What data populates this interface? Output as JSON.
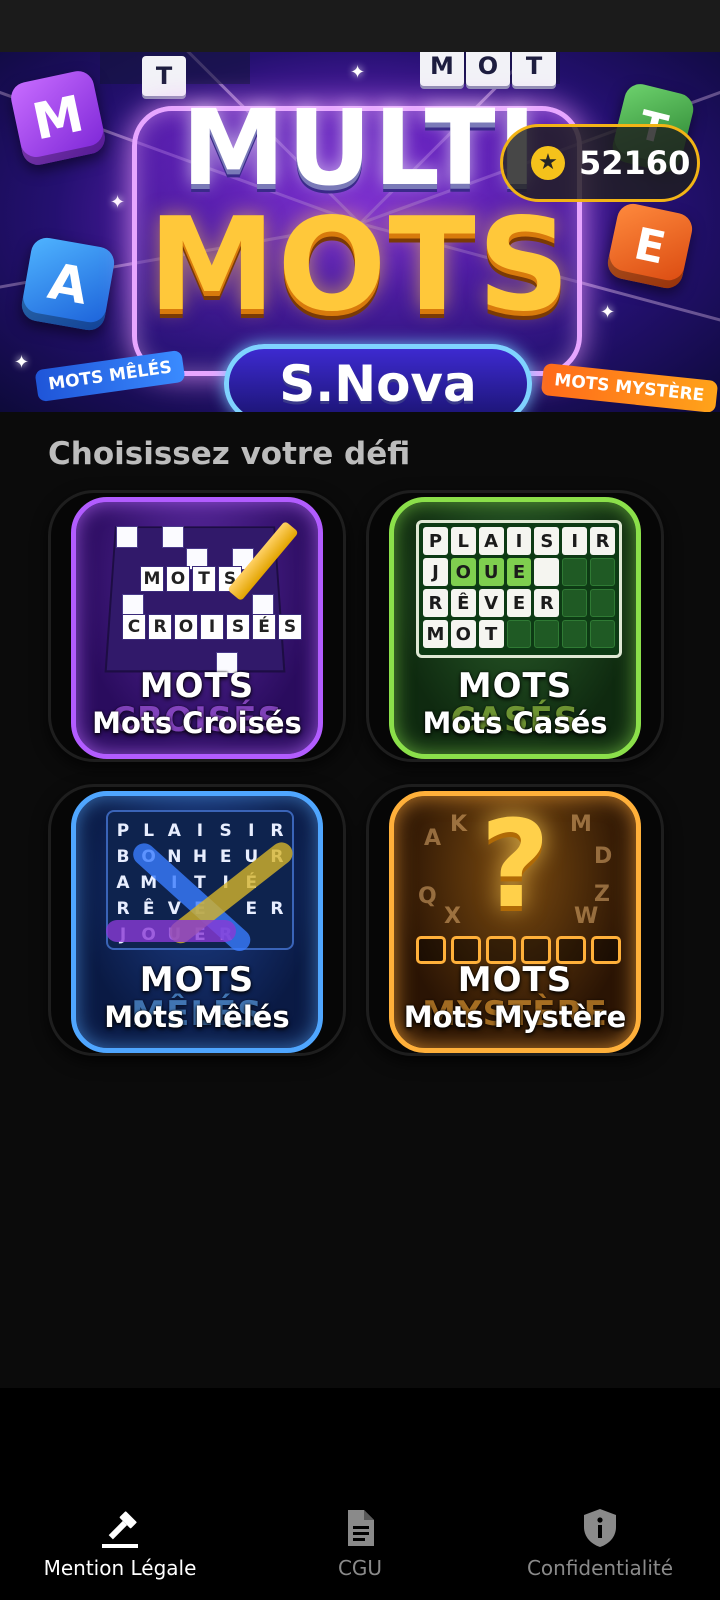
{
  "banner": {
    "title_line1": "MULTI",
    "title_line2": "MOTS",
    "subtitle": "S.Nova",
    "ribbon_left": "MOTS MÊLÉS",
    "ribbon_right": "MOTS MYSTÈRE",
    "cube_letters": [
      "M",
      "A",
      "E",
      "T"
    ],
    "top_tiles": [
      "T",
      "M",
      "O",
      "T"
    ]
  },
  "coins": {
    "icon": "star-coin-icon",
    "value": "52160",
    "accent_color": "#f2b416"
  },
  "section_title": "Choisissez votre défi",
  "games": [
    {
      "id": "croises",
      "art_heading": "MOTS",
      "art_heading_2": "CROISÉS",
      "name": "Mots Croisés",
      "art_words": [
        "MOTS",
        "CROISÉS"
      ],
      "accent_color": "#b25cff"
    },
    {
      "id": "cases",
      "art_heading": "MOTS",
      "art_heading_2": "CASÉS",
      "name": "Mots Casés",
      "art_words": [
        "PLAISIR",
        "JOUE",
        "RÊVER",
        "MOT"
      ],
      "accent_color": "#8be04a"
    },
    {
      "id": "meles",
      "art_heading": "MOTS",
      "art_heading_2": "MÊLÉS",
      "name": "Mots Mêlés",
      "art_words": [
        "PLAISIR",
        "BONHEUR",
        "AMITIÉ",
        "RÊVER",
        "JOUER"
      ],
      "accent_color": "#4fa6ff"
    },
    {
      "id": "mystere",
      "art_heading": "MOTS",
      "art_heading_2": "MYSTÈRE",
      "name": "Mots Mystère",
      "art_symbol": "?",
      "art_letters": [
        "A",
        "K",
        "M",
        "D",
        "Q",
        "X",
        "W",
        "Z"
      ],
      "accent_color": "#ffb03a"
    }
  ],
  "bottom_nav": [
    {
      "label": "Mention Légale",
      "icon": "gavel-icon",
      "active": true
    },
    {
      "label": "CGU",
      "icon": "document-icon",
      "active": false
    },
    {
      "label": "Confidentialité",
      "icon": "shield-info-icon",
      "active": false
    }
  ]
}
